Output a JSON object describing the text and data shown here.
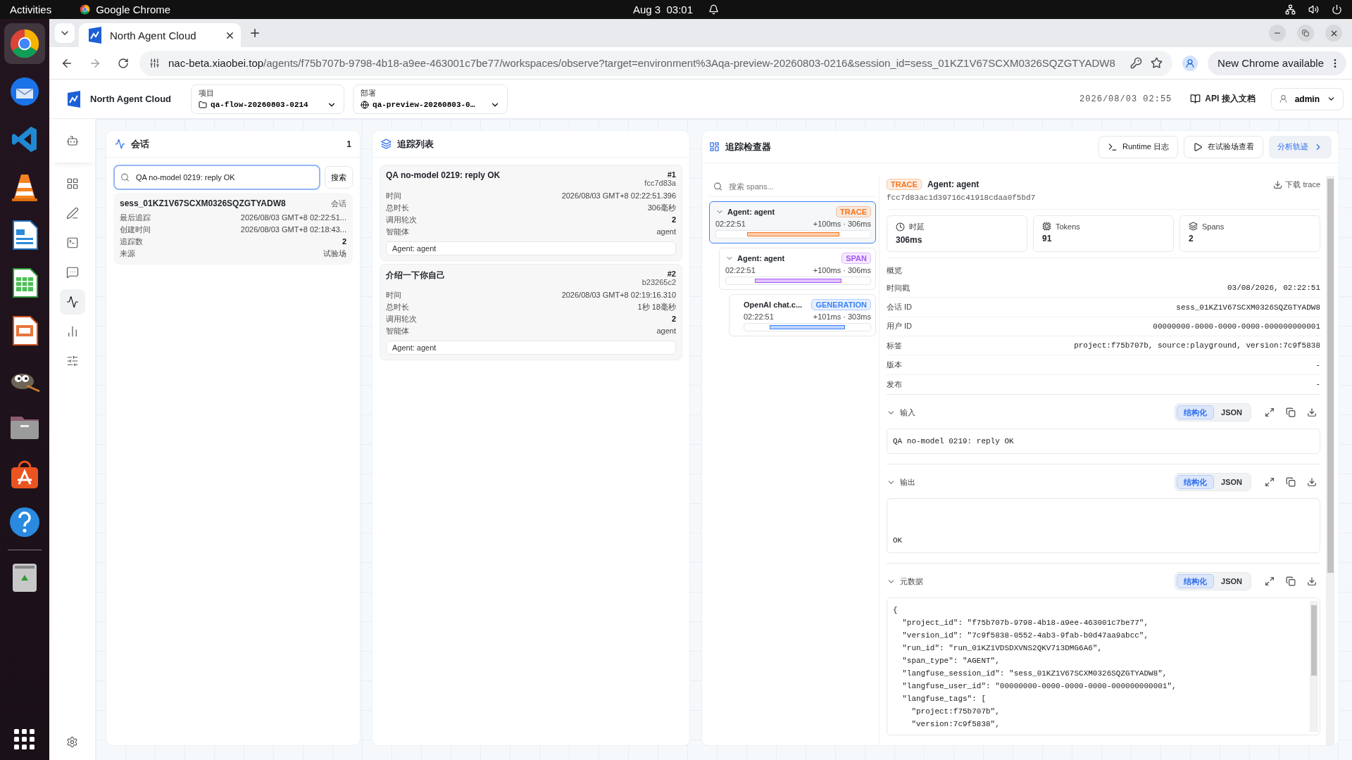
{
  "system_bar": {
    "activities": "Activities",
    "app_name": "Google Chrome",
    "clock": "Aug 3  03:01"
  },
  "browser": {
    "tab_title": "North Agent Cloud",
    "url_host": "nac-beta.xiaobei.top",
    "url_path": "/agents/f75b707b-9798-4b18-a9ee-463001c7be77/workspaces/observe?target=environment%3Aqa-preview-20260803-0216&session_id=sess_01KZ1V67SCXM0326SQZGTYADW8",
    "update_button": "New Chrome available"
  },
  "header": {
    "brand": "North Agent Cloud",
    "project_label": "项目",
    "project_value": "qa-flow-20260803-0214",
    "deploy_label": "部署",
    "deploy_value": "qa-preview-20260803-0…",
    "datetime": "2026/08/03 02:55",
    "docs_link": "API 接入文档",
    "user": "admin"
  },
  "nav_items": [
    {
      "selected": false
    },
    {
      "selected": false
    },
    {
      "selected": false
    },
    {
      "selected": false
    },
    {
      "selected": false
    },
    {
      "selected": true
    },
    {
      "selected": false
    },
    {
      "selected": false
    }
  ],
  "sessions_panel": {
    "title": "会话",
    "count": "1",
    "search_value": "QA no-model 0219: reply OK",
    "search_button": "搜索",
    "sessions": [
      {
        "id": "sess_01KZ1V67SCXM0326SQZGTYADW8",
        "kind_label": "会话",
        "fields": [
          {
            "label": "最后追踪",
            "value": "2026/08/03 GMT+8 02:22:51...",
            "strong": false
          },
          {
            "label": "创建时间",
            "value": "2026/08/03 GMT+8 02:18:43...",
            "strong": false
          },
          {
            "label": "追踪数",
            "value": "2",
            "strong": true
          },
          {
            "label": "来源",
            "value": "试验场",
            "strong": false
          }
        ]
      }
    ]
  },
  "traces_panel": {
    "title": "追踪列表",
    "traces": [
      {
        "title": "QA no-model 0219: reply OK",
        "number": "#1",
        "hash": "fcc7d83a",
        "tag": "Agent: agent",
        "fields": [
          {
            "label": "时间",
            "value": "2026/08/03 GMT+8 02:22:51.396",
            "strong": false
          },
          {
            "label": "总时长",
            "value": "306毫秒",
            "strong": false
          },
          {
            "label": "调用轮次",
            "value": "2",
            "strong": true
          },
          {
            "label": "智能体",
            "value": "agent",
            "strong": false
          }
        ]
      },
      {
        "title": "介绍一下你自己",
        "number": "#2",
        "hash": "b23265c2",
        "tag": "Agent: agent",
        "fields": [
          {
            "label": "时间",
            "value": "2026/08/03 GMT+8 02:19:16.310",
            "strong": false
          },
          {
            "label": "总时长",
            "value": "1秒 18毫秒",
            "strong": false
          },
          {
            "label": "调用轮次",
            "value": "2",
            "strong": true
          },
          {
            "label": "智能体",
            "value": "agent",
            "strong": false
          }
        ]
      }
    ]
  },
  "inspector": {
    "title": "追踪检查器",
    "buttons": [
      {
        "label": "Runtime 日志",
        "kind": "terminal"
      },
      {
        "label": "在试验场查看",
        "kind": "play"
      },
      {
        "label": "分析轨迹",
        "kind": "primary"
      }
    ],
    "span_search_placeholder": "搜索 spans...",
    "spans": [
      {
        "name": "Agent: agent",
        "badge": "TRACE",
        "color": "#f97316",
        "time": "02:22:51",
        "timing": "+100ms · 306ms",
        "selected": true,
        "expanded": true,
        "children": [
          {
            "name": "Agent: agent",
            "badge": "SPAN",
            "color": "#a855f7",
            "time": "02:22:51",
            "timing": "+100ms · 306ms",
            "selected": false,
            "expanded": true,
            "children": [
              {
                "name": "OpenAI chat.c...",
                "badge": "GENERATION",
                "color": "#3b82f6",
                "time": "02:22:51",
                "timing": "+101ms · 303ms",
                "selected": false
              }
            ]
          }
        ]
      }
    ],
    "detail": {
      "badge": "TRACE",
      "name": "Agent: agent",
      "trace_id": "fcc7d83ac1d39716c41918cdaa0f5bd7",
      "download": "下载 trace",
      "stats": [
        {
          "kind": "clock",
          "label": "时延",
          "value": "306ms"
        },
        {
          "kind": "chip",
          "label": "Tokens",
          "value": "91"
        },
        {
          "kind": "layers",
          "label": "Spans",
          "value": "2"
        }
      ],
      "overview_title": "概览",
      "overview": [
        {
          "label": "时间戳",
          "value": "03/08/2026, 02:22:51"
        },
        {
          "label": "会话 ID",
          "value": "sess_01KZ1V67SCXM0326SQZGTYADW8"
        },
        {
          "label": "用户 ID",
          "value": "00000000-0000-0000-0000-000000000001"
        },
        {
          "label": "标签",
          "value": "project:f75b707b, source:playground, version:7c9f5838"
        },
        {
          "label": "版本",
          "value": "-"
        },
        {
          "label": "发布",
          "value": "-"
        }
      ],
      "sections": [
        {
          "kind": "input",
          "title": "输入",
          "expanded": true,
          "views": [
            {
              "label": "结构化",
              "selected": true
            },
            {
              "label": "JSON",
              "selected": false
            }
          ],
          "lines": [
            "QA no-model 0219: reply OK"
          ]
        },
        {
          "kind": "output",
          "title": "输出",
          "expanded": true,
          "views": [
            {
              "label": "结构化",
              "selected": true
            },
            {
              "label": "JSON",
              "selected": false
            }
          ],
          "lines": [
            "OK"
          ]
        },
        {
          "kind": "metadata",
          "title": "元数据",
          "expanded": true,
          "views": [
            {
              "label": "结构化",
              "selected": true
            },
            {
              "label": "JSON",
              "selected": false
            }
          ],
          "lines": [
            "{",
            "  \"project_id\": \"f75b707b-9798-4b18-a9ee-463001c7be77\",",
            "  \"version_id\": \"7c9f5838-0552-4ab3-9fab-b0d47aa9abcc\",",
            "  \"run_id\": \"run_01KZ1VDSDXVNS2QKV713DMG6A6\",",
            "  \"span_type\": \"AGENT\",",
            "  \"langfuse_session_id\": \"sess_01KZ1V67SCXM0326SQZGTYADW8\",",
            "  \"langfuse_user_id\": \"00000000-0000-0000-0000-000000000001\",",
            "  \"langfuse_tags\": [",
            "    \"project:f75b707b\",",
            "    \"version:7c9f5838\","
          ]
        }
      ]
    }
  }
}
